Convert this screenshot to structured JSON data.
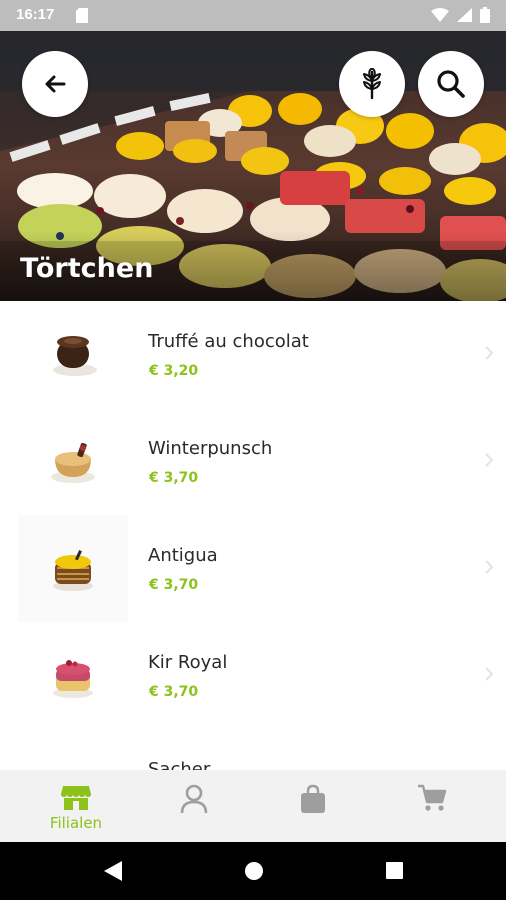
{
  "status_bar": {
    "time": "16:17"
  },
  "header": {
    "title": "Törtchen"
  },
  "icons": {
    "back": "arrow-left-icon",
    "filter": "grain-icon",
    "search": "search-icon"
  },
  "products": [
    {
      "name": "Truffé au chocolat",
      "price": "€ 3,20"
    },
    {
      "name": "Winterpunsch",
      "price": "€ 3,70"
    },
    {
      "name": "Antigua",
      "price": "€ 3,70"
    },
    {
      "name": "Kir Royal",
      "price": "€ 3,70"
    },
    {
      "name": "Sacher",
      "price": ""
    }
  ],
  "bottom_nav": {
    "items": [
      {
        "label": "Filialen",
        "icon": "store-icon",
        "active": true
      },
      {
        "label": "",
        "icon": "user-icon",
        "active": false
      },
      {
        "label": "",
        "icon": "bag-icon",
        "active": false
      },
      {
        "label": "",
        "icon": "cart-icon",
        "active": false
      }
    ]
  },
  "colors": {
    "accent": "#8cc21a",
    "inactive_icon": "#9e9e9e",
    "nav_bg": "#f2f2f2"
  }
}
